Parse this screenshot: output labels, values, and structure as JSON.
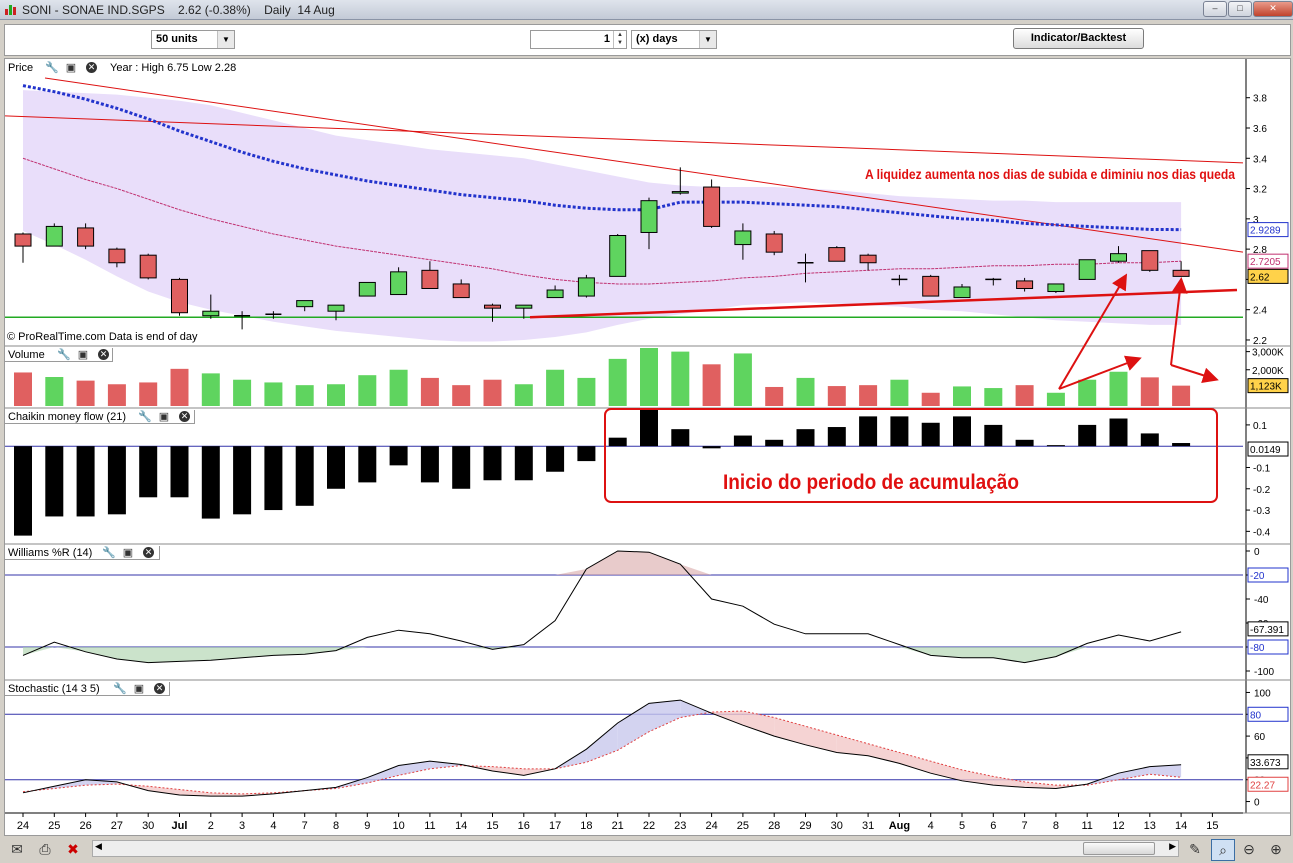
{
  "window": {
    "title": "SONI - SONAE IND.SGPS    2.62 (-0.38%)    Daily  14 Aug",
    "min_label": "–",
    "max_label": "□",
    "close_label": "✕"
  },
  "toolbar": {
    "units_value": "50 units",
    "interval_value": "1",
    "period_value": "(x) days",
    "indicator_button": "Indicator/Backtest"
  },
  "panels": {
    "price": {
      "label": "Price",
      "range_text": "Year : High 6.75 Low 2.28",
      "footer": "© ProRealTime.com  Data is end of day"
    },
    "volume": {
      "label": "Volume"
    },
    "chaikin": {
      "label": "Chaikin money flow (21)"
    },
    "williams": {
      "label": "Williams %R (14)"
    },
    "stochastic": {
      "label": "Stochastic (14 3 5)"
    }
  },
  "annotations": {
    "liquidity_note": "A liquidez aumenta nos dias de subida e diminiu nos dias queda",
    "accumulation_note": "Inicio do periodo de acumulação"
  },
  "colors": {
    "up": "#5fd45f",
    "down": "#e06060",
    "ma_blue": "#2233cc",
    "trend_red": "#dd1111",
    "band": "#e9defa",
    "support_green": "#22aa22",
    "ref_line": "#3333aa"
  },
  "chart_data": [
    {
      "type": "candlestick",
      "title": "Price",
      "x": [
        "24",
        "25",
        "26",
        "27",
        "30",
        "Jul",
        "2",
        "3",
        "4",
        "7",
        "8",
        "9",
        "10",
        "11",
        "14",
        "15",
        "16",
        "17",
        "18",
        "21",
        "22",
        "23",
        "24",
        "25",
        "28",
        "29",
        "30",
        "31",
        "Aug",
        "4",
        "5",
        "6",
        "7",
        "8",
        "11",
        "12",
        "13",
        "14",
        "15"
      ],
      "ohlc": [
        [
          2.9,
          2.91,
          2.71,
          2.82
        ],
        [
          2.82,
          2.97,
          2.82,
          2.95
        ],
        [
          2.94,
          2.97,
          2.8,
          2.82
        ],
        [
          2.8,
          2.81,
          2.68,
          2.71
        ],
        [
          2.76,
          2.77,
          2.6,
          2.61
        ],
        [
          2.6,
          2.61,
          2.36,
          2.38
        ],
        [
          2.36,
          2.5,
          2.34,
          2.39
        ],
        [
          2.36,
          2.39,
          2.27,
          2.36
        ],
        [
          2.37,
          2.39,
          2.34,
          2.37
        ],
        [
          2.42,
          2.46,
          2.39,
          2.46
        ],
        [
          2.39,
          2.43,
          2.33,
          2.43
        ],
        [
          2.49,
          2.58,
          2.49,
          2.58
        ],
        [
          2.5,
          2.68,
          2.5,
          2.65
        ],
        [
          2.66,
          2.72,
          2.54,
          2.54
        ],
        [
          2.57,
          2.6,
          2.48,
          2.48
        ],
        [
          2.43,
          2.44,
          2.32,
          2.41
        ],
        [
          2.41,
          2.43,
          2.34,
          2.43
        ],
        [
          2.48,
          2.56,
          2.48,
          2.53
        ],
        [
          2.49,
          2.63,
          2.48,
          2.61
        ],
        [
          2.62,
          2.9,
          2.62,
          2.89
        ],
        [
          2.91,
          3.14,
          2.8,
          3.12
        ],
        [
          3.17,
          3.34,
          3.16,
          3.18
        ],
        [
          3.21,
          3.26,
          2.94,
          2.95
        ],
        [
          2.83,
          2.97,
          2.73,
          2.92
        ],
        [
          2.9,
          2.92,
          2.76,
          2.78
        ],
        [
          2.71,
          2.77,
          2.58,
          2.71
        ],
        [
          2.81,
          2.82,
          2.72,
          2.72
        ],
        [
          2.76,
          2.77,
          2.66,
          2.71
        ],
        [
          2.6,
          2.63,
          2.56,
          2.6
        ],
        [
          2.62,
          2.63,
          2.49,
          2.49
        ],
        [
          2.48,
          2.57,
          2.48,
          2.55
        ],
        [
          2.6,
          2.61,
          2.56,
          2.6
        ],
        [
          2.59,
          2.61,
          2.52,
          2.54
        ],
        [
          2.52,
          2.57,
          2.51,
          2.57
        ],
        [
          2.6,
          2.73,
          2.6,
          2.73
        ],
        [
          2.72,
          2.82,
          2.71,
          2.77
        ],
        [
          2.79,
          2.79,
          2.65,
          2.66
        ],
        [
          2.66,
          2.72,
          2.63,
          2.62
        ]
      ],
      "ma_blue": [
        3.88,
        3.84,
        3.79,
        3.73,
        3.66,
        3.58,
        3.51,
        3.44,
        3.38,
        3.33,
        3.29,
        3.25,
        3.22,
        3.19,
        3.16,
        3.14,
        3.12,
        3.09,
        3.07,
        3.06,
        3.06,
        3.11,
        3.11,
        3.11,
        3.1,
        3.09,
        3.08,
        3.06,
        3.04,
        3.02,
        3.0,
        2.99,
        2.97,
        2.96,
        2.95,
        2.94,
        2.93,
        2.9289
      ],
      "ma_red": [
        3.4,
        3.33,
        3.26,
        3.2,
        3.13,
        3.06,
        3.0,
        2.95,
        2.9,
        2.86,
        2.82,
        2.79,
        2.76,
        2.73,
        2.7,
        2.67,
        2.63,
        2.6,
        2.58,
        2.57,
        2.57,
        2.58,
        2.59,
        2.61,
        2.62,
        2.64,
        2.65,
        2.66,
        2.67,
        2.67,
        2.68,
        2.69,
        2.69,
        2.7,
        2.7,
        2.71,
        2.71,
        2.7205
      ],
      "band_upper": [
        3.85,
        3.84,
        3.83,
        3.82,
        3.8,
        3.78,
        3.75,
        3.7,
        3.65,
        3.6,
        3.55,
        3.52,
        3.49,
        3.46,
        3.44,
        3.42,
        3.4,
        3.36,
        3.32,
        3.28,
        3.24,
        3.22,
        3.21,
        3.21,
        3.21,
        3.2,
        3.19,
        3.17,
        3.15,
        3.14,
        3.13,
        3.12,
        3.12,
        3.11,
        3.11,
        3.11,
        3.11,
        3.11
      ],
      "band_lower": [
        2.92,
        2.83,
        2.73,
        2.62,
        2.52,
        2.45,
        2.4,
        2.36,
        2.32,
        2.29,
        2.26,
        2.24,
        2.22,
        2.2,
        2.19,
        2.19,
        2.2,
        2.22,
        2.25,
        2.3,
        2.34,
        2.37,
        2.4,
        2.43,
        2.44,
        2.45,
        2.44,
        2.43,
        2.42,
        2.4,
        2.39,
        2.37,
        2.35,
        2.33,
        2.32,
        2.31,
        2.3,
        2.3
      ],
      "support_level": 2.35,
      "ylim": [
        2.18,
        3.95
      ],
      "yticks": [
        "2.2",
        "2.4",
        "2.6",
        "2.8",
        "3",
        "3.2",
        "3.4",
        "3.6",
        "3.8"
      ],
      "last_labels": {
        "ma_blue": "2.9289",
        "ma_red": "2.7205",
        "close": "2.62"
      }
    },
    {
      "type": "bar",
      "title": "Volume",
      "values": [
        1850,
        1600,
        1400,
        1200,
        1300,
        2050,
        1800,
        1450,
        1300,
        1150,
        1200,
        1700,
        2000,
        1550,
        1150,
        1450,
        1200,
        2000,
        1550,
        2600,
        3200,
        3000,
        2300,
        2900,
        1050,
        1550,
        1100,
        1150,
        1450,
        730,
        1080,
        990,
        1150,
        730,
        1450,
        1890,
        1580,
        1123
      ],
      "ylim": [
        0,
        3200
      ],
      "yticks": [
        "3,000K",
        "2,000K"
      ],
      "last_label": "1,123K"
    },
    {
      "type": "bar",
      "title": "Chaikin money flow (21)",
      "values": [
        -0.42,
        -0.33,
        -0.33,
        -0.32,
        -0.24,
        -0.24,
        -0.34,
        -0.32,
        -0.3,
        -0.28,
        -0.2,
        -0.17,
        -0.09,
        -0.17,
        -0.2,
        -0.16,
        -0.16,
        -0.12,
        -0.07,
        0.04,
        0.17,
        0.08,
        -0.01,
        0.05,
        0.03,
        0.08,
        0.09,
        0.14,
        0.14,
        0.11,
        0.14,
        0.1,
        0.03,
        0.005,
        0.1,
        0.13,
        0.06,
        0.0149
      ],
      "ylim": [
        -0.45,
        0.17
      ],
      "yticks": [
        "0.1",
        "-0.1",
        "-0.2",
        "-0.3",
        "-0.4"
      ],
      "last_label": "0.0149"
    },
    {
      "type": "line",
      "title": "Williams %R (14)",
      "values": [
        -87,
        -76,
        -84,
        -90,
        -93,
        -92,
        -91,
        -89,
        -87,
        -86,
        -83,
        -72,
        -66,
        -69,
        -75,
        -82,
        -78,
        -58,
        -15,
        0,
        -1,
        -11,
        -40,
        -46,
        -61,
        -69,
        -69,
        -69,
        -78,
        -87,
        -89,
        -89,
        -93,
        -88,
        -77,
        -70,
        -75,
        -67.391
      ],
      "ylim": [
        -100,
        0
      ],
      "levels": [
        -20,
        -80
      ],
      "yticks": [
        "0",
        "-20",
        "-40",
        "-60",
        "-80",
        "-100"
      ],
      "last_label": "-67.391",
      "level_labels": [
        "-20",
        "-80"
      ]
    },
    {
      "type": "line",
      "title": "Stochastic (14 3 5)",
      "series": [
        {
          "values": [
            8,
            14,
            20,
            18,
            10,
            6,
            5,
            5,
            7,
            10,
            13,
            22,
            33,
            37,
            34,
            28,
            24,
            30,
            48,
            72,
            90,
            93,
            81,
            70,
            60,
            52,
            45,
            42,
            35,
            26,
            19,
            15,
            13,
            12,
            16,
            26,
            32,
            33.673
          ]
        },
        {
          "values": [
            9,
            12,
            15,
            16,
            14,
            11,
            8,
            7,
            8,
            10,
            12,
            17,
            24,
            30,
            33,
            32,
            30,
            30,
            36,
            47,
            64,
            77,
            82,
            83,
            77,
            69,
            61,
            53,
            45,
            37,
            29,
            23,
            18,
            15,
            15,
            20,
            25,
            22.27
          ]
        }
      ],
      "ylim": [
        -5,
        105
      ],
      "levels": [
        20,
        80
      ],
      "yticks": [
        "100",
        "80",
        "60",
        "40",
        "20",
        "0"
      ],
      "last_labels": [
        "33.673",
        "22.27"
      ],
      "level_labels": [
        "80"
      ]
    }
  ]
}
